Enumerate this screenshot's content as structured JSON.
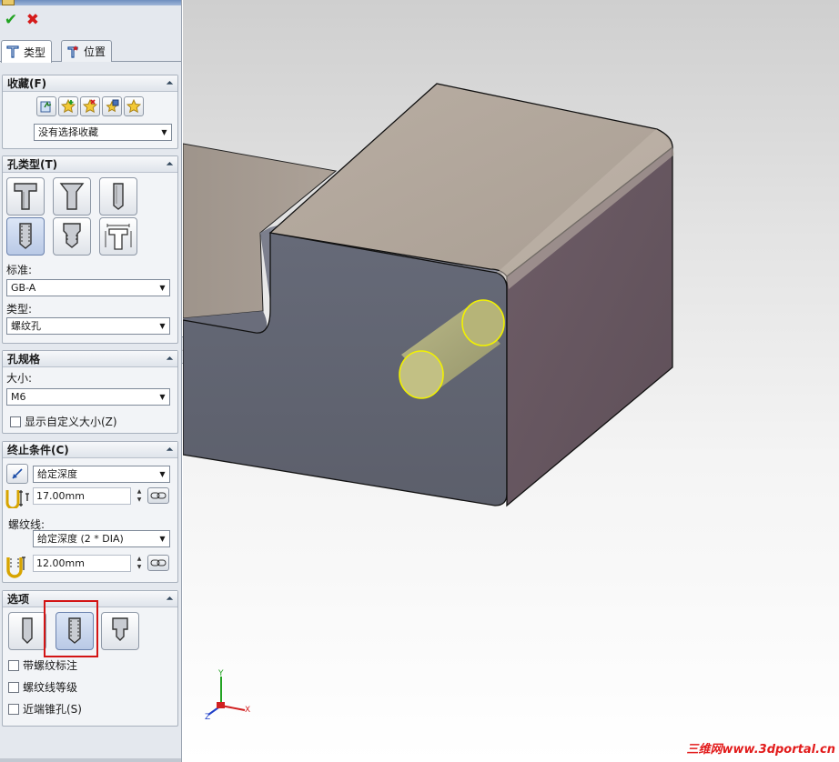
{
  "toolbar": {
    "ok_icon": "check-icon",
    "cancel_icon": "close-icon"
  },
  "tabs": [
    {
      "label": "类型",
      "icon": "hole-type-icon",
      "active": true
    },
    {
      "label": "位置",
      "icon": "hole-position-icon",
      "active": false
    }
  ],
  "favorites": {
    "title": "收藏(F)",
    "buttons": [
      "apply-defaults-icon",
      "add-favorite-icon",
      "delete-favorite-icon",
      "save-favorite-icon",
      "load-favorite-icon"
    ],
    "combo_value": "没有选择收藏"
  },
  "hole_type": {
    "title": "孔类型(T)",
    "buttons": [
      {
        "name": "counterbore-icon",
        "selected": false
      },
      {
        "name": "countersink-icon",
        "selected": false
      },
      {
        "name": "simple-hole-icon",
        "selected": false
      },
      {
        "name": "tapped-hole-icon",
        "selected": true
      },
      {
        "name": "pipe-tap-icon",
        "selected": false
      },
      {
        "name": "legacy-hole-icon",
        "selected": false
      }
    ],
    "standard_label": "标准:",
    "standard_value": "GB-A",
    "type_label": "类型:",
    "type_value": "螺纹孔"
  },
  "hole_spec": {
    "title": "孔规格",
    "size_label": "大小:",
    "size_value": "M6",
    "custom_size_label": "显示自定义大小(Z)"
  },
  "end_condition": {
    "title": "终止条件(C)",
    "condition_value": "给定深度",
    "depth_value": "17.00mm",
    "thread_label": "螺纹线:",
    "thread_value": "给定深度 (2 * DIA)",
    "thread_depth_value": "12.00mm"
  },
  "options": {
    "title": "选项",
    "buttons": [
      {
        "name": "tap-drill-icon",
        "selected": false
      },
      {
        "name": "cosmetic-thread-icon",
        "selected": true
      },
      {
        "name": "remove-thread-icon",
        "selected": false
      }
    ],
    "checkboxes": [
      "带螺纹标注",
      "螺纹线等级",
      "近端锥孔(S)"
    ]
  },
  "triad": {
    "x": "X",
    "y": "Y",
    "z": "Z"
  },
  "watermark": "三维网www.3dportal.cn",
  "colors": {
    "accent": "#6b82ad",
    "highlight": "#d31414",
    "part_front": "#5f6270",
    "part_side": "#6a5a62",
    "part_top": "#b2a79d",
    "hole_edge": "#f2f200"
  }
}
